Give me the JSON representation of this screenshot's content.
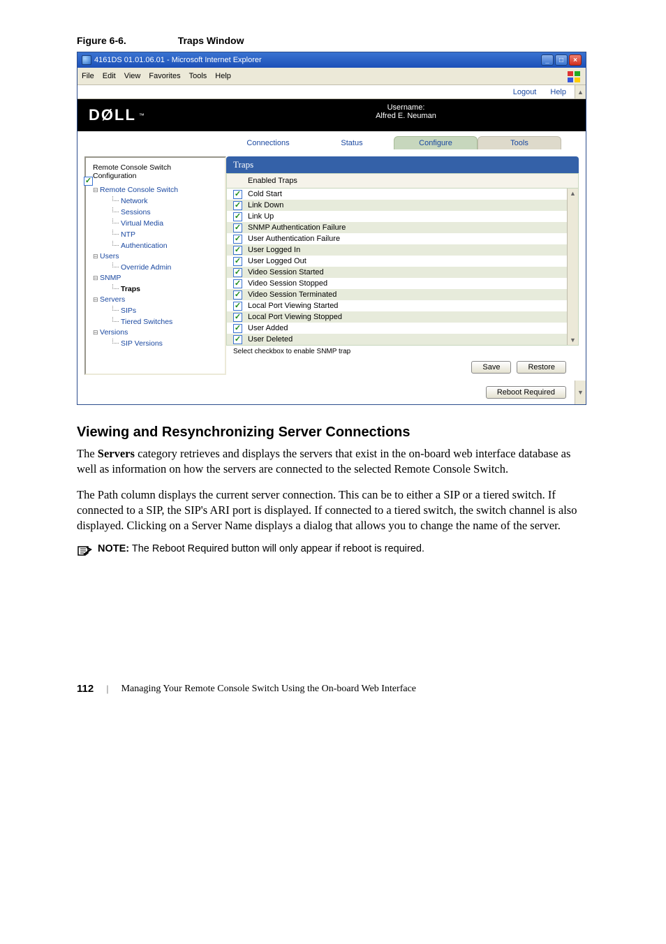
{
  "caption": {
    "label": "Figure 6-6.",
    "title": "Traps Window"
  },
  "window": {
    "title": "4161DS 01.01.06.01 - Microsoft Internet Explorer",
    "menus": {
      "file": "File",
      "edit": "Edit",
      "view": "View",
      "favorites": "Favorites",
      "tools": "Tools",
      "help": "Help"
    },
    "header": {
      "logout": "Logout",
      "help": "Help",
      "brand": "DØLL",
      "tm": "™",
      "user_label": "Username:",
      "user_name": "Alfred E. Neuman"
    },
    "tabs": {
      "connections": "Connections",
      "status": "Status",
      "configure": "Configure",
      "tools": "Tools"
    },
    "side": {
      "title_l1": "Remote Console Switch",
      "title_l2": "Configuration",
      "items": {
        "rcs": "Remote Console Switch",
        "network": "Network",
        "sessions": "Sessions",
        "vmedia": "Virtual Media",
        "ntp": "NTP",
        "auth": "Authentication",
        "users": "Users",
        "override": "Override Admin",
        "snmp": "SNMP",
        "traps": "Traps",
        "servers": "Servers",
        "sips": "SIPs",
        "tiered": "Tiered Switches",
        "versions": "Versions",
        "sipver": "SIP Versions"
      }
    },
    "pane_title": "Traps",
    "col_header": "Enabled Traps",
    "traps": [
      "Cold Start",
      "Link Down",
      "Link Up",
      "SNMP Authentication Failure",
      "User Authentication Failure",
      "User Logged In",
      "User Logged Out",
      "Video Session Started",
      "Video Session Stopped",
      "Video Session Terminated",
      "Local Port Viewing Started",
      "Local Port Viewing Stopped",
      "User Added",
      "User Deleted"
    ],
    "select_text": "Select checkbox to enable SNMP trap",
    "buttons": {
      "save": "Save",
      "restore": "Restore",
      "reboot": "Reboot Required"
    }
  },
  "section_heading": "Viewing and Resynchronizing Server Connections",
  "para1_a": "The ",
  "para1_bold": "Servers",
  "para1_b": " category retrieves and displays the servers that exist in the on-board web interface database as well as information on how the servers are connected to the selected Remote Console Switch.",
  "para2": "The Path column displays the current server connection. This can be to either a SIP or a tiered switch. If connected to a SIP, the SIP's ARI port is displayed. If connected to a tiered switch, the switch channel is also displayed. Clicking on a Server Name displays a dialog that allows you to change the name of the server.",
  "note": {
    "label": "NOTE:",
    "text": " The Reboot Required button will only appear if reboot is required."
  },
  "footer": {
    "page_no": "112",
    "text": "Managing Your Remote Console Switch Using the On-board Web Interface"
  }
}
